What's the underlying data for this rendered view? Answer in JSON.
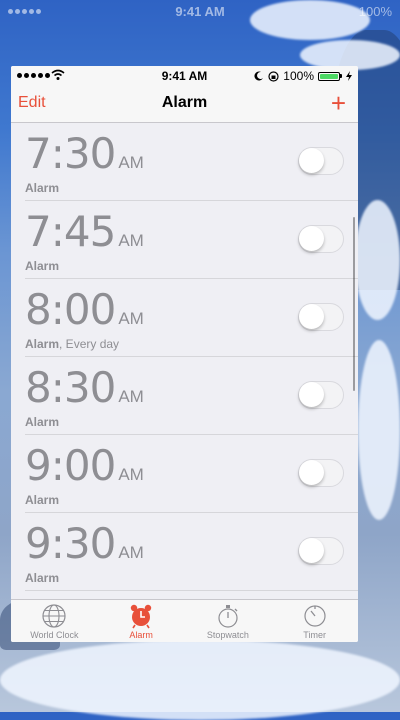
{
  "background_status": {
    "time": "9:41 AM",
    "battery": "100%"
  },
  "status_bar": {
    "time": "9:41 AM",
    "battery_percent": "100%"
  },
  "nav": {
    "edit_label": "Edit",
    "title": "Alarm",
    "add_label": "+"
  },
  "alarms": [
    {
      "time": "7:30",
      "ampm": "AM",
      "label": "Alarm",
      "repeat": "",
      "enabled": false
    },
    {
      "time": "7:45",
      "ampm": "AM",
      "label": "Alarm",
      "repeat": "",
      "enabled": false
    },
    {
      "time": "8:00",
      "ampm": "AM",
      "label": "Alarm",
      "repeat": ", Every day",
      "enabled": false
    },
    {
      "time": "8:30",
      "ampm": "AM",
      "label": "Alarm",
      "repeat": "",
      "enabled": false
    },
    {
      "time": "9:00",
      "ampm": "AM",
      "label": "Alarm",
      "repeat": "",
      "enabled": false
    },
    {
      "time": "9:30",
      "ampm": "AM",
      "label": "Alarm",
      "repeat": "",
      "enabled": false
    }
  ],
  "tabs": [
    {
      "label": "World Clock",
      "icon": "globe-icon",
      "active": false
    },
    {
      "label": "Alarm",
      "icon": "alarm-clock-icon",
      "active": true
    },
    {
      "label": "Stopwatch",
      "icon": "stopwatch-icon",
      "active": false
    },
    {
      "label": "Timer",
      "icon": "timer-icon",
      "active": false
    }
  ],
  "colors": {
    "accent": "#e8503a",
    "battery": "#4cd964",
    "text_muted": "#8e8e93"
  }
}
